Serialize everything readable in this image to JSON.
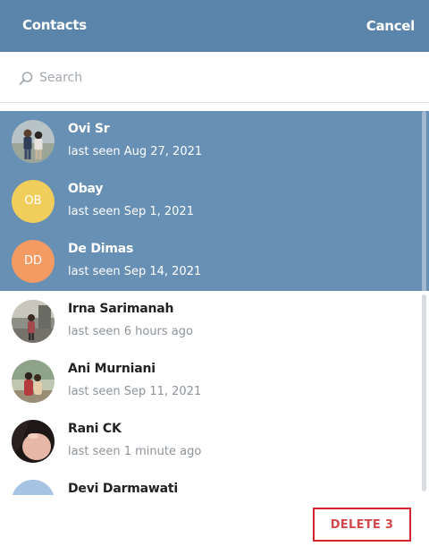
{
  "header": {
    "title": "Contacts",
    "cancel_label": "Cancel"
  },
  "search": {
    "placeholder": "Search",
    "value": ""
  },
  "contacts": [
    {
      "name": "Ovi Sr",
      "status": "last seen Aug 27, 2021",
      "selected": true,
      "avatar": "photo"
    },
    {
      "name": "Obay",
      "status": "last seen Sep 1, 2021",
      "selected": true,
      "initials": "OB",
      "avatar_color": "#f1cd5c"
    },
    {
      "name": "De Dimas",
      "status": "last seen Sep 14, 2021",
      "selected": true,
      "initials": "DD",
      "avatar_color": "#f49a63"
    },
    {
      "name": "Irna Sarimanah",
      "status": "last seen 6 hours ago",
      "selected": false,
      "avatar": "photo"
    },
    {
      "name": "Ani Murniani",
      "status": "last seen Sep 11, 2021",
      "selected": false,
      "avatar": "photo"
    },
    {
      "name": "Rani CK",
      "status": "last seen 1 minute ago",
      "selected": false,
      "avatar": "photo"
    },
    {
      "name": "Devi Darmawati",
      "status": "",
      "selected": false,
      "avatar": "photo"
    }
  ],
  "footer": {
    "delete_label": "DELETE 3"
  },
  "colors": {
    "header": "#5b84ab",
    "selected_row": "#6890b5",
    "delete_border": "#d4242c"
  }
}
